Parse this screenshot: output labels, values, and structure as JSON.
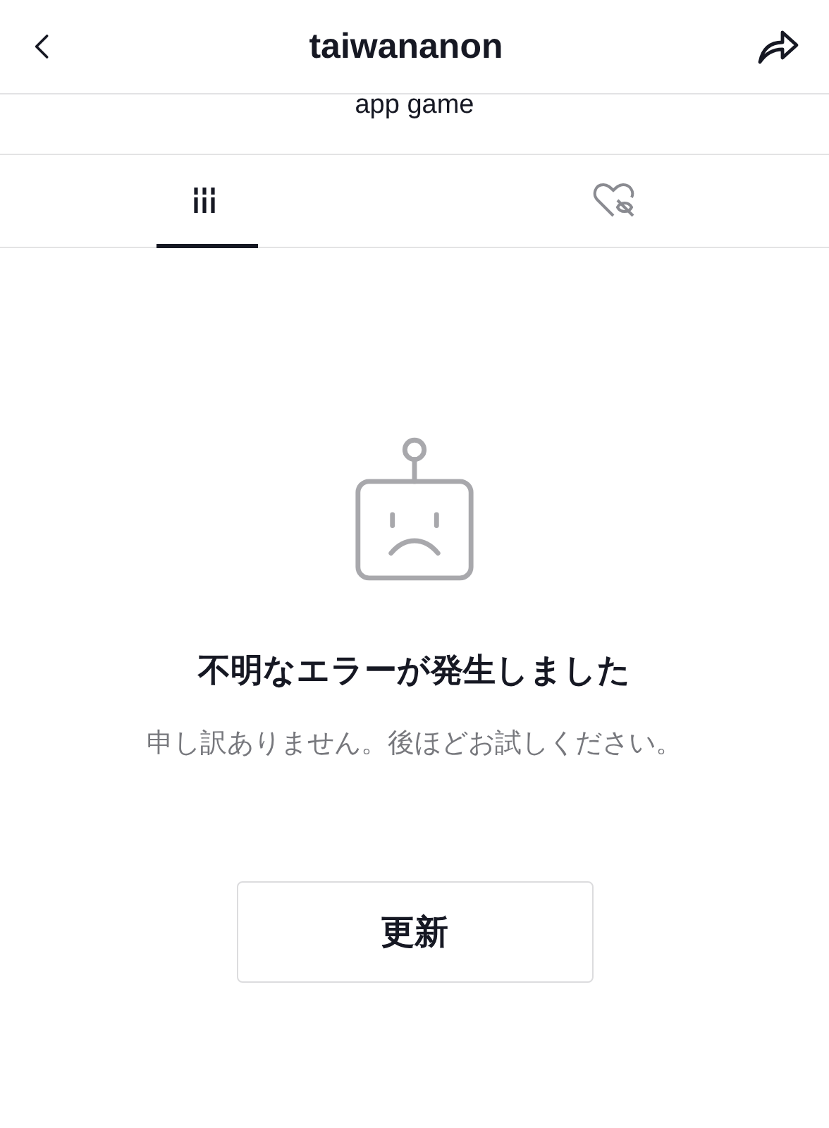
{
  "header": {
    "title": "taiwananon"
  },
  "profile": {
    "subtitle": "app game"
  },
  "tabs": [
    {
      "kind": "grid",
      "selected": true
    },
    {
      "kind": "liked",
      "selected": false
    }
  ],
  "error": {
    "title": "不明なエラーが発生しました",
    "message": "申し訳ありません。後ほどお試しください。",
    "button": "更新"
  }
}
